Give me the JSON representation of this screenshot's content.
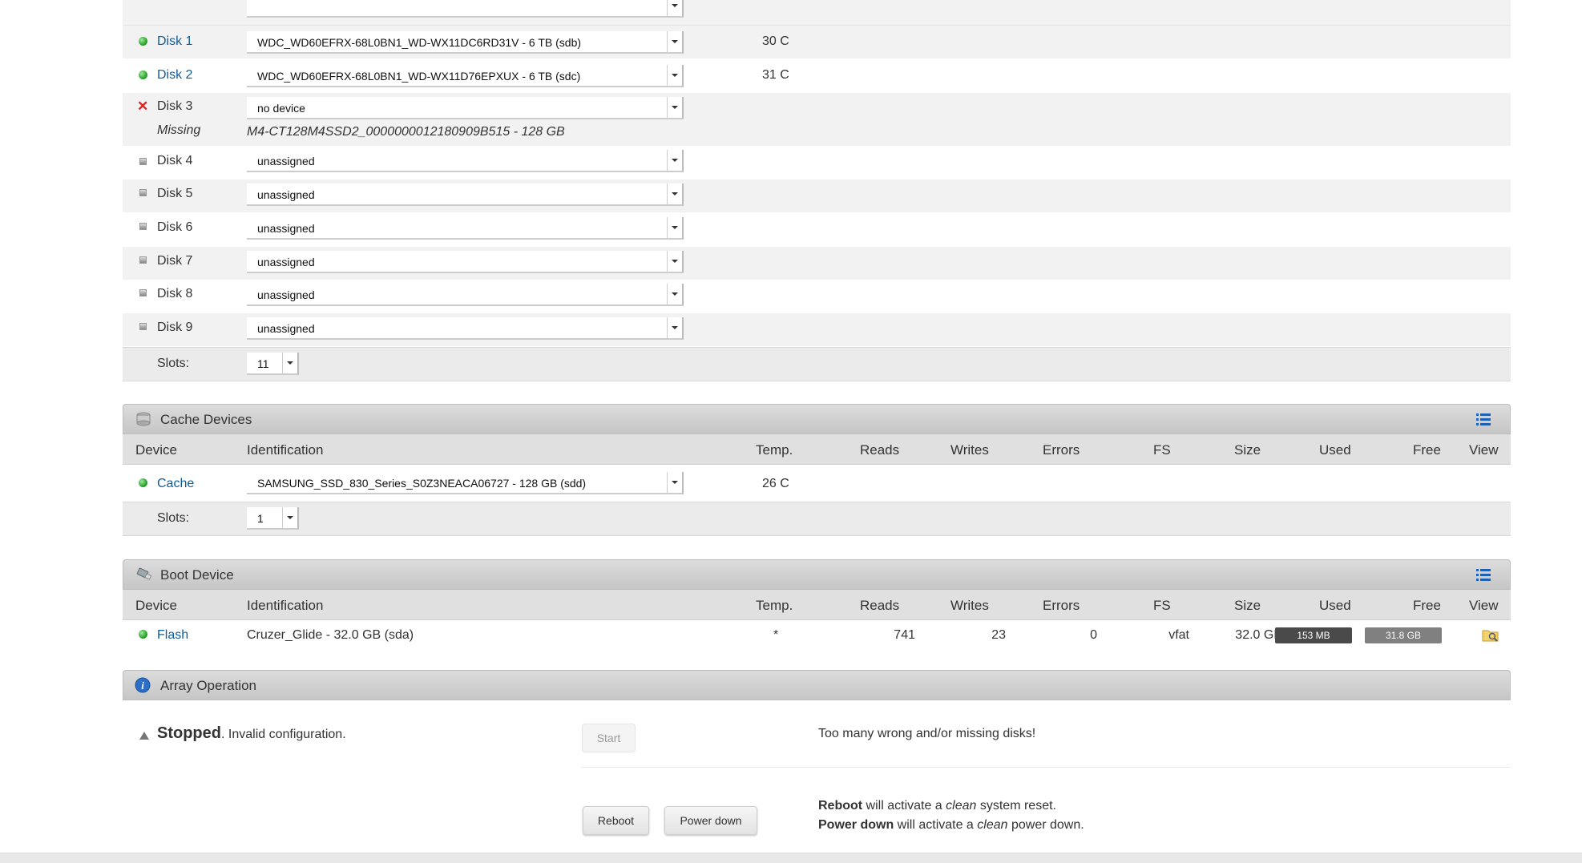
{
  "array_devices": {
    "disks": [
      {
        "name": "Disk 1",
        "status": "active",
        "device": "WDC_WD60EFRX-68L0BN1_WD-WX11DC6RD31V - 6 TB (sdb)",
        "temp": "30 C"
      },
      {
        "name": "Disk 2",
        "status": "active",
        "device": "WDC_WD60EFRX-68L0BN1_WD-WX11D76EPXUX - 6 TB (sdc)",
        "temp": "31 C"
      },
      {
        "name": "Disk 3",
        "status": "missing",
        "device": "no device",
        "missing_label": "Missing",
        "missing_device": "M4-CT128M4SSD2_0000000012180909B515 - 128 GB"
      },
      {
        "name": "Disk 4",
        "status": "unassigned",
        "device": "unassigned"
      },
      {
        "name": "Disk 5",
        "status": "unassigned",
        "device": "unassigned"
      },
      {
        "name": "Disk 6",
        "status": "unassigned",
        "device": "unassigned"
      },
      {
        "name": "Disk 7",
        "status": "unassigned",
        "device": "unassigned"
      },
      {
        "name": "Disk 8",
        "status": "unassigned",
        "device": "unassigned"
      },
      {
        "name": "Disk 9",
        "status": "unassigned",
        "device": "unassigned"
      }
    ],
    "slots_label": "Slots:",
    "slots_value": "11"
  },
  "columns": {
    "device": "Device",
    "identification": "Identification",
    "temp": "Temp.",
    "reads": "Reads",
    "writes": "Writes",
    "errors": "Errors",
    "fs": "FS",
    "size": "Size",
    "used": "Used",
    "free": "Free",
    "view": "View"
  },
  "cache_devices": {
    "title": "Cache Devices",
    "device_name": "Cache",
    "device": "SAMSUNG_SSD_830_Series_S0Z3NEACA06727 - 128 GB (sdd)",
    "temp": "26 C",
    "slots_label": "Slots:",
    "slots_value": "1"
  },
  "boot_device": {
    "title": "Boot Device",
    "device_name": "Flash",
    "identification": "Cruzer_Glide - 32.0 GB (sda)",
    "temp": "*",
    "reads": "741",
    "writes": "23",
    "errors": "0",
    "fs": "vfat",
    "size": "32.0 GB",
    "used": "153 MB",
    "free": "31.8 GB",
    "used_fraction": 0.005
  },
  "array_operation": {
    "title": "Array Operation",
    "status_word": "Stopped",
    "status_rest": ". Invalid configuration.",
    "start_label": "Start",
    "message": "Too many wrong and/or missing disks!",
    "reboot_label": "Reboot",
    "powerdown_label": "Power down",
    "reboot_bold": "Reboot",
    "reboot_pre": " will activate a ",
    "reboot_em": "clean",
    "reboot_post": " system reset.",
    "power_bold": "Power down",
    "power_pre": " will activate a ",
    "power_em": "clean",
    "power_post": " power down."
  },
  "colors": {
    "link": "#0d5d9e",
    "used_bar": "#4a4a4a",
    "free_bar": "#808080"
  }
}
